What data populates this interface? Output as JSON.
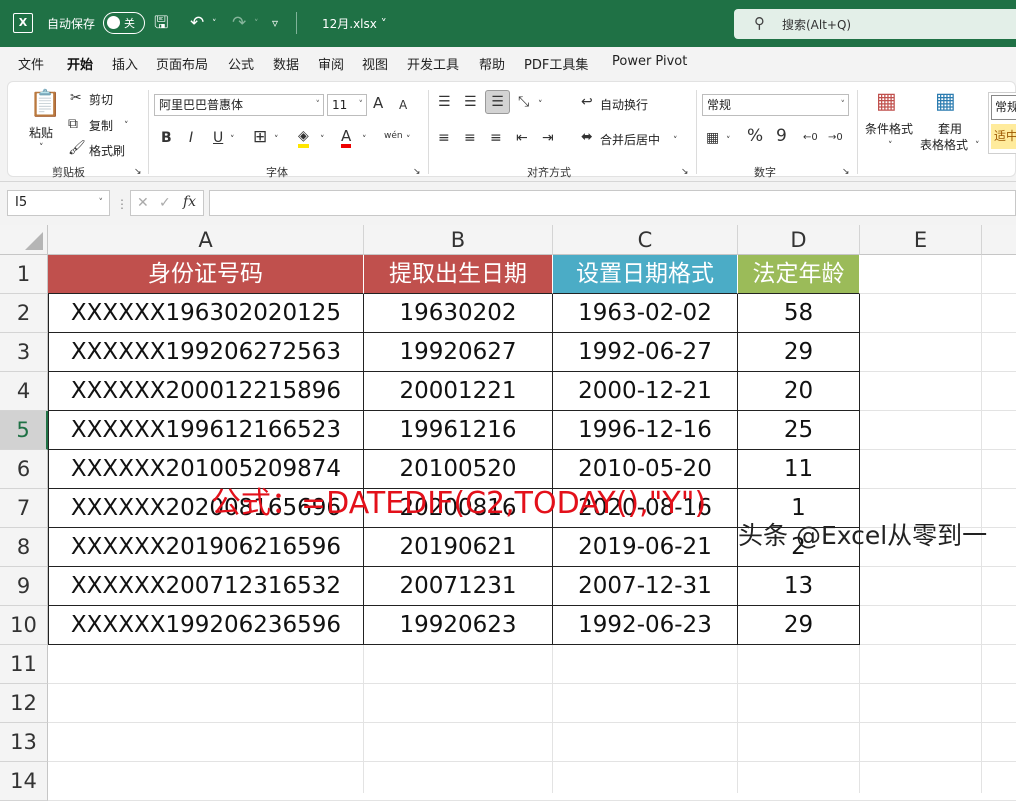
{
  "titlebar": {
    "logo": "X",
    "autosave_label": "自动保存",
    "autosave_state": "关",
    "filename": "12月.xlsx ˅",
    "search_text": "搜索(Alt+Q)"
  },
  "menu": [
    "文件",
    "开始",
    "插入",
    "页面布局",
    "公式",
    "数据",
    "审阅",
    "视图",
    "开发工具",
    "帮助",
    "PDF工具集",
    "Power Pivot"
  ],
  "ribbon": {
    "clipboard": {
      "paste": "粘贴",
      "cut": "剪切",
      "copy": "复制",
      "format_painter": "格式刷",
      "label": "剪贴板"
    },
    "font": {
      "name": "阿里巴巴普惠体",
      "size": "11",
      "label": "字体",
      "bold": "B",
      "italic": "I",
      "underline": "U",
      "grow": "A",
      "shrink": "A",
      "wen": "wén"
    },
    "alignment": {
      "wrap": "自动换行",
      "merge": "合并后居中",
      "label": "对齐方式"
    },
    "number": {
      "format": "常规",
      "percent": "%",
      "comma": "9",
      "label": "数字"
    },
    "styles": {
      "conditional": "条件格式",
      "table_1": "套用",
      "table_2": "表格格式",
      "style_normal": "常规",
      "style_neutral": "适中"
    }
  },
  "formula_bar": {
    "name_box": "I5",
    "formula": ""
  },
  "sheet": {
    "columns": [
      "A",
      "B",
      "C",
      "D",
      "E"
    ],
    "rows": [
      "1",
      "2",
      "3",
      "4",
      "5",
      "6",
      "7",
      "8",
      "9",
      "10",
      "11",
      "12",
      "13",
      "14"
    ],
    "selected_row": 5,
    "header": [
      "身份证号码",
      "提取出生日期",
      "设置日期格式",
      "法定年龄"
    ],
    "header_colors": [
      "#c0504d",
      "#c0504d",
      "#4bacc6",
      "#9bbb59"
    ],
    "data": [
      [
        "XXXXXX196302020125",
        "19630202",
        "1963-02-02",
        "58"
      ],
      [
        "XXXXXX199206272563",
        "19920627",
        "1992-06-27",
        "29"
      ],
      [
        "XXXXXX200012215896",
        "20001221",
        "2000-12-21",
        "20"
      ],
      [
        "XXXXXX199612166523",
        "19961216",
        "1996-12-16",
        "25"
      ],
      [
        "XXXXXX201005209874",
        "20100520",
        "2010-05-20",
        "11"
      ],
      [
        "XXXXXX202008165696",
        "20200816",
        "2020-08-16",
        "1"
      ],
      [
        "XXXXXX201906216596",
        "20190621",
        "2019-06-21",
        "2"
      ],
      [
        "XXXXXX200712316532",
        "20071231",
        "2007-12-31",
        "13"
      ],
      [
        "XXXXXX199206236596",
        "19920623",
        "1992-06-23",
        "29"
      ]
    ]
  },
  "annotation": "公式：=DATEDIF(C2,TODAY(),\"Y\")",
  "watermark": "头条 @Excel从零到一",
  "icons": {
    "undo": "undo-icon",
    "redo": "redo-icon",
    "save": "save-icon",
    "search": "search-icon",
    "accent_color": "#1f7145"
  }
}
